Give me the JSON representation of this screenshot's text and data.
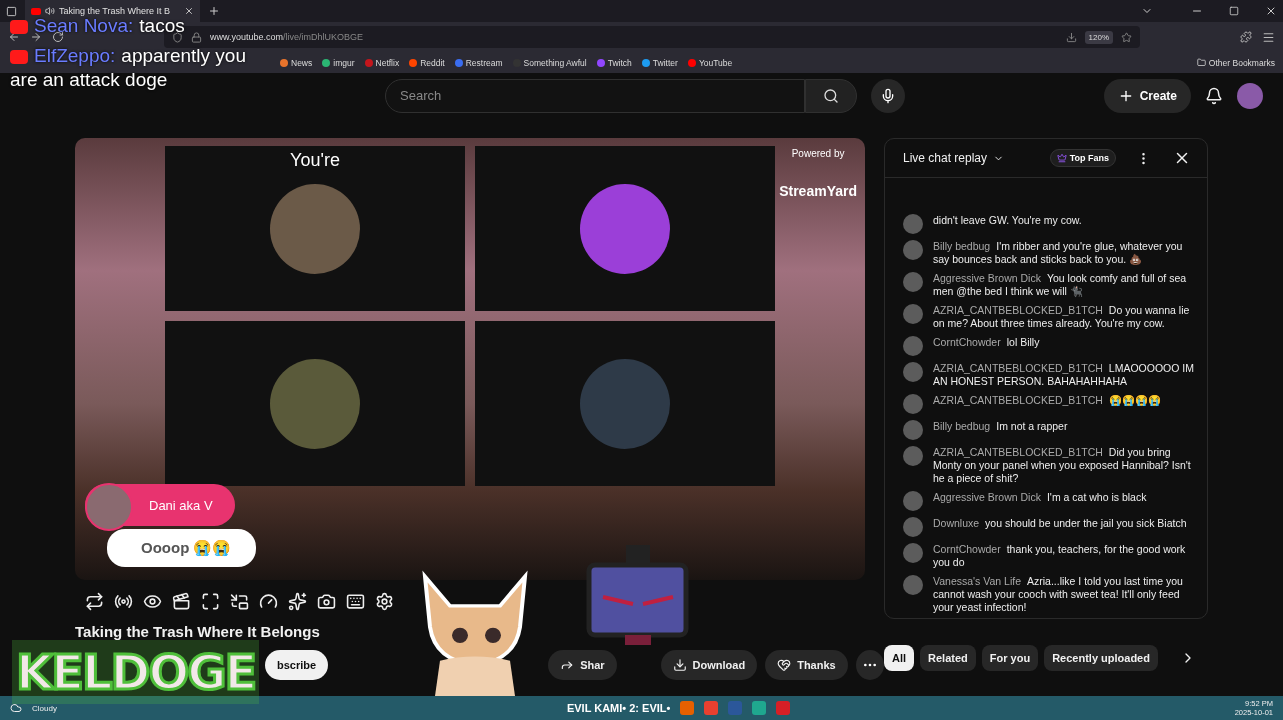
{
  "browser": {
    "tab": {
      "title": "Taking the Trash Where It B",
      "audio": true
    },
    "url": {
      "host": "www.youtube.com",
      "path": "/live/imDhlUKOBGE"
    },
    "zoom": "120%",
    "bookmarks": [
      {
        "label": "News",
        "color": "#e8742c"
      },
      {
        "label": "imgur",
        "color": "#2bb673"
      },
      {
        "label": "Netflix",
        "color": "#c4161c"
      },
      {
        "label": "Reddit",
        "color": "#ff4500"
      },
      {
        "label": "Restream",
        "color": "#3a6df0"
      },
      {
        "label": "Something Awful",
        "color": "#333333"
      },
      {
        "label": "Twitch",
        "color": "#9146ff"
      },
      {
        "label": "Twitter",
        "color": "#1d9bf0"
      },
      {
        "label": "YouTube",
        "color": "#ff0000"
      }
    ],
    "other_bookmarks": "Other Bookmarks"
  },
  "header": {
    "search": {
      "placeholder": "Search"
    },
    "create": "Create"
  },
  "video": {
    "label": "You're",
    "branding": {
      "line1": "Powered by",
      "line2": "StreamYard"
    },
    "comment": {
      "name": "Dani aka V",
      "text": "Oooop 😭😭"
    }
  },
  "title": "Taking the Trash Where It Belongs",
  "actions": [
    {
      "kind": "subscribe",
      "label": "bscribe"
    },
    {
      "kind": "share",
      "label": "Shar"
    },
    {
      "kind": "download",
      "label": "Download"
    },
    {
      "kind": "thanks",
      "label": "Thanks"
    }
  ],
  "chat": {
    "title": "Live chat replay",
    "filter": "Top Fans",
    "messages": [
      {
        "text": "didn't leave GW. You're my cow."
      },
      {
        "author": "Billy bedbug",
        "text": "I'm ribber and you're glue, whatever you say bounces back and sticks back to you. 💩"
      },
      {
        "author": "Aggressive Brown Dick",
        "text": "You look comfy and full of sea men @the bed I think we will 🐈‍⬛"
      },
      {
        "author": "AZRIA_CANTBEBLOCKED_B1TCH",
        "text": "Do you wanna lie on me? About three times already. You're my cow."
      },
      {
        "author": "CorntChowder",
        "text": "lol Billy"
      },
      {
        "author": "AZRIA_CANTBEBLOCKED_B1TCH",
        "text": "LMAOOOOOO IM AN HONEST PERSON. BAHAHAHHAHA"
      },
      {
        "author": "AZRIA_CANTBEBLOCKED_B1TCH",
        "text": "😭😭😭😭"
      },
      {
        "author": "Billy bedbug",
        "text": "Im not a rapper"
      },
      {
        "author": "AZRIA_CANTBEBLOCKED_B1TCH",
        "text": "Did you bring Monty on your panel when you exposed Hannibal? Isn't he a piece of shit?"
      },
      {
        "author": "Aggressive Brown Dick",
        "text": "I'm a cat who is black"
      },
      {
        "author": "Downluxe",
        "text": "you should be under the jail you sick Biatch"
      },
      {
        "author": "CorntChowder",
        "text": "thank you, teachers, for the good work you do"
      },
      {
        "author": "Vanessa's Van Life",
        "text": "Azria...like I told you last time you cannot wash your cooch with sweet tea! It'll only feed your yeast infection!"
      }
    ]
  },
  "chips": [
    {
      "label": "All",
      "selected": true
    },
    {
      "label": "Related",
      "selected": false
    },
    {
      "label": "For you",
      "selected": false
    },
    {
      "label": "Recently uploaded",
      "selected": false
    }
  ],
  "stream_overlay": {
    "messages": [
      {
        "author": "Sean Nova:",
        "text": "tacos"
      },
      {
        "author": "ElfZeppo:",
        "text": "apparently you are an attack doge"
      }
    ],
    "logo": "KELDOGE"
  },
  "taskbar": {
    "weather": "Cloudy",
    "app_title": "EVIL KAMI• 2: EVIL•",
    "time": "9:52 PM",
    "date": "2025-10-01"
  }
}
